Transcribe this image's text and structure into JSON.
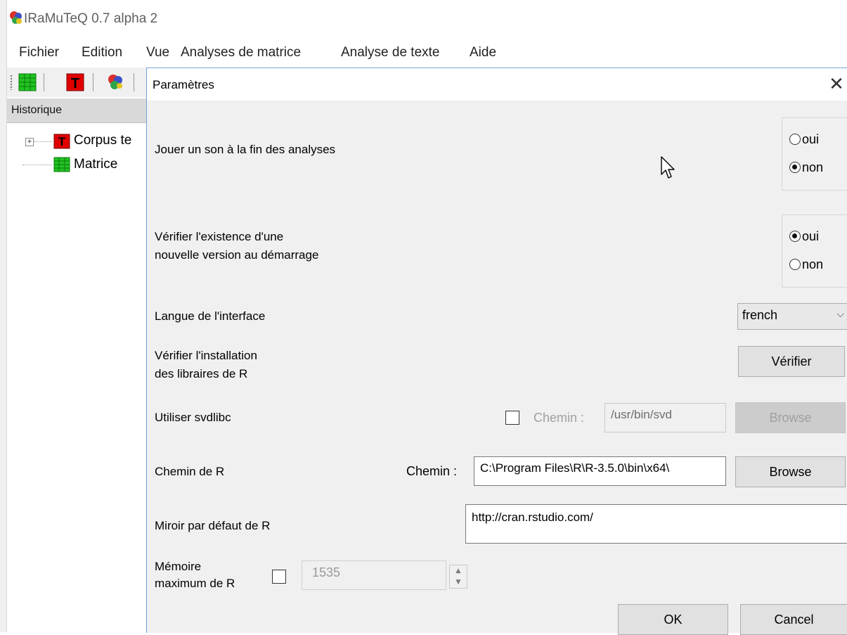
{
  "app": {
    "title": "IRaMuTeQ 0.7 alpha 2",
    "icon": "iramuteq-logo-icon"
  },
  "menu": {
    "items": [
      "Fichier",
      "Edition",
      "Vue",
      "Analyses de matrice",
      "Analyse de texte",
      "Aide"
    ]
  },
  "toolbar": {
    "buttons": [
      "matrix-icon",
      "text-corpus-icon",
      "iramuteq-logo-icon"
    ]
  },
  "history": {
    "header": "Historique",
    "items": [
      {
        "label": "Corpus te",
        "icon": "text-corpus-icon",
        "expandable": true
      },
      {
        "label": "Matrice",
        "icon": "matrix-icon",
        "expandable": false
      }
    ]
  },
  "dialog": {
    "title": "Paramètres",
    "close_icon": "close-icon",
    "sound": {
      "label": "Jouer un son à la fin des analyses",
      "options": [
        "oui",
        "non"
      ],
      "selected": "non"
    },
    "update_check": {
      "label_line1": "Vérifier l'existence d'une",
      "label_line2": "nouvelle version au démarrage",
      "options": [
        "oui",
        "non"
      ],
      "selected": "oui"
    },
    "language": {
      "label": "Langue de l'interface",
      "value": "french"
    },
    "r_libs": {
      "label_line1": "Vérifier l'installation",
      "label_line2": "des libraires de R",
      "button": "Vérifier"
    },
    "svdlibc": {
      "label": "Utiliser svdlibc",
      "checked": false,
      "path_label": "Chemin :",
      "path_value": "/usr/bin/svd",
      "browse": "Browse",
      "enabled": false
    },
    "r_path": {
      "label": "Chemin de R",
      "path_label": "Chemin :",
      "path_value": "C:\\Program Files\\R\\R-3.5.0\\bin\\x64\\",
      "browse": "Browse"
    },
    "r_mirror": {
      "label": "Miroir par défaut de R",
      "value": "http://cran.rstudio.com/"
    },
    "r_memory": {
      "label_line1": "Mémoire",
      "label_line2": "maximum de R",
      "checked": false,
      "value": "1535"
    },
    "ok": "OK",
    "cancel": "Cancel"
  },
  "colors": {
    "dialog_bg": "#f0f0f0",
    "dialog_border": "#6fa3d8",
    "corpus_icon": "#e00000",
    "matrix_icon": "#22c322"
  }
}
